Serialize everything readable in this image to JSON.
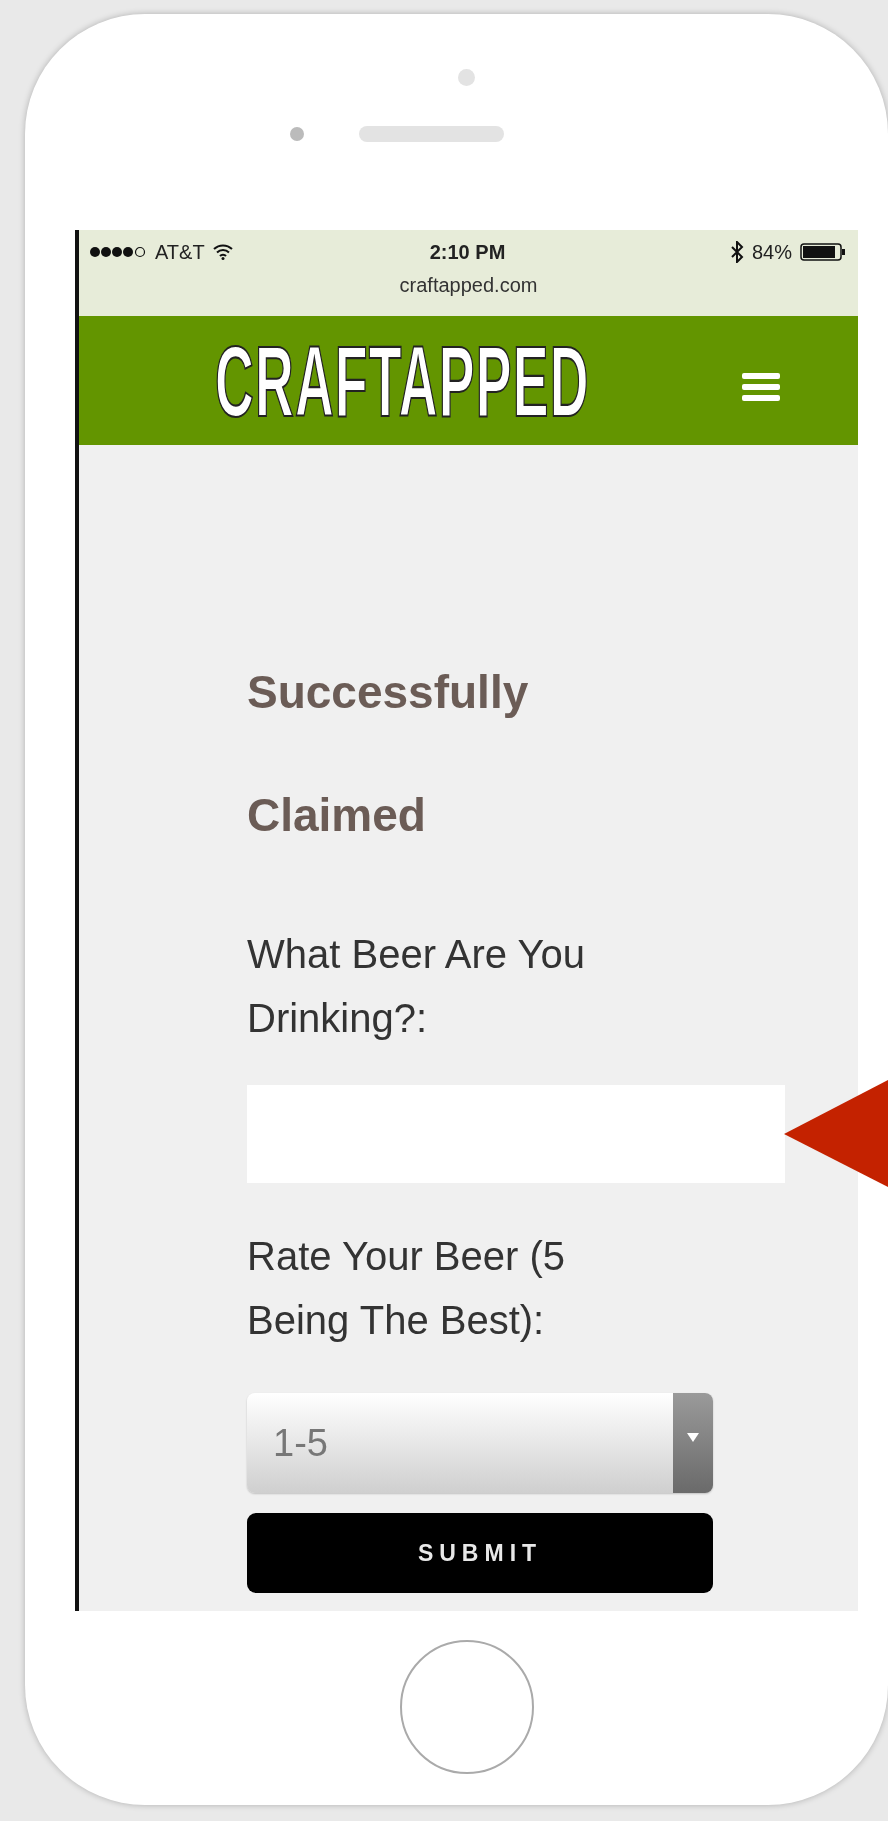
{
  "status_bar": {
    "carrier": "AT&T",
    "time": "2:10 PM",
    "battery": "84%",
    "url": "craftapped.com"
  },
  "header": {
    "logo": "CRAFTAPPED"
  },
  "form": {
    "heading_lines": [
      "Successfully",
      "Claimed"
    ],
    "fields": [
      {
        "kind": "text",
        "label_lines": [
          "What Beer Are You",
          "Drinking?:"
        ]
      },
      {
        "kind": "select",
        "label_lines": [
          "Rate Your Beer (5",
          "Being The Best):"
        ],
        "value": "1-5"
      }
    ],
    "submit": "SUBMIT"
  }
}
